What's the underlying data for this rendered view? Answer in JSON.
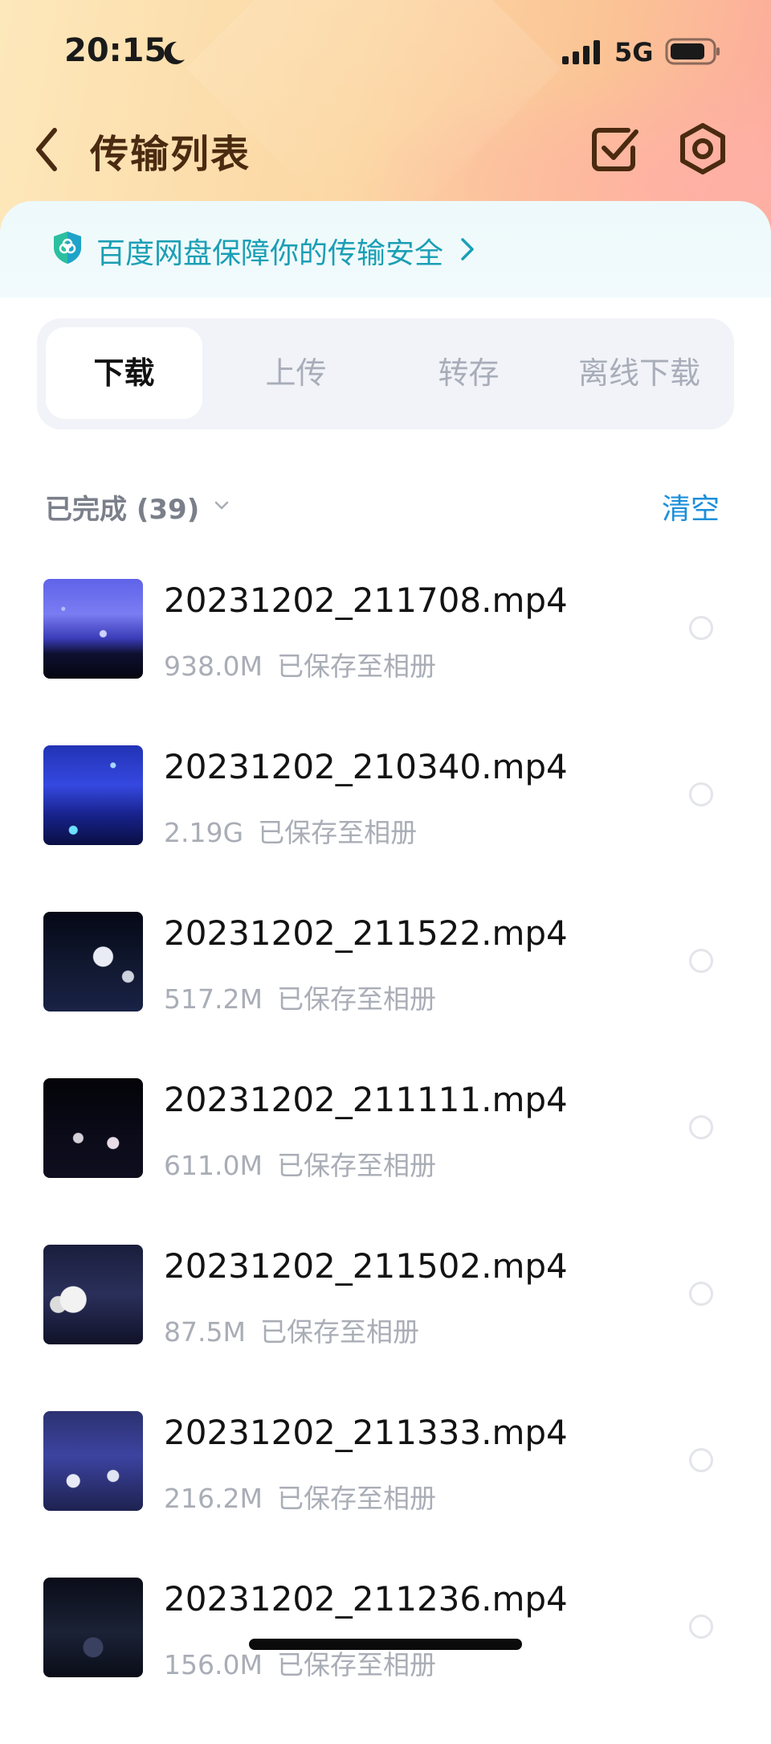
{
  "status_bar": {
    "time": "20:15",
    "network": "5G",
    "icons": [
      "moon-icon",
      "signal-icon",
      "battery-icon"
    ]
  },
  "title_bar": {
    "title": "传输列表",
    "icons": [
      "back-icon",
      "select-icon",
      "settings-icon"
    ]
  },
  "security_banner": {
    "text": "百度网盘保障你的传输安全",
    "icon": "shield-icon"
  },
  "tabs": [
    {
      "label": "下载",
      "active": true
    },
    {
      "label": "上传",
      "active": false
    },
    {
      "label": "转存",
      "active": false
    },
    {
      "label": "离线下载",
      "active": false
    }
  ],
  "section": {
    "title": "已完成 (39)",
    "clear_label": "清空"
  },
  "files": [
    {
      "name": "20231202_211708.mp4",
      "size": "938.0M",
      "status": "已保存至相册"
    },
    {
      "name": "20231202_210340.mp4",
      "size": "2.19G",
      "status": "已保存至相册"
    },
    {
      "name": "20231202_211522.mp4",
      "size": "517.2M",
      "status": "已保存至相册"
    },
    {
      "name": "20231202_211111.mp4",
      "size": "611.0M",
      "status": "已保存至相册"
    },
    {
      "name": "20231202_211502.mp4",
      "size": "87.5M",
      "status": "已保存至相册"
    },
    {
      "name": "20231202_211333.mp4",
      "size": "216.2M",
      "status": "已保存至相册"
    },
    {
      "name": "20231202_211236.mp4",
      "size": "156.0M",
      "status": "已保存至相册"
    }
  ],
  "colors": {
    "title": "#4a2a10",
    "accent_blue": "#1c8fd9",
    "banner_text": "#1a9fb5",
    "muted_text": "#a9adb6"
  }
}
